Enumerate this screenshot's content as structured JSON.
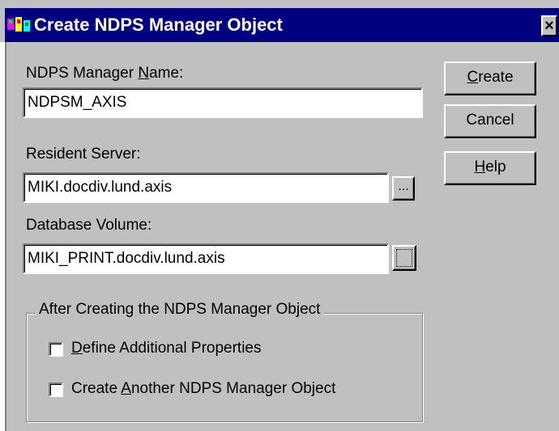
{
  "window": {
    "title": "Create NDPS Manager Object",
    "close_label": "×"
  },
  "manager_name": {
    "label_pre": "NDPS Manager ",
    "label_access": "N",
    "label_post": "ame:",
    "value": "NDPSM_AXIS"
  },
  "resident_server": {
    "label": "Resident Server:",
    "value": "MIKI.docdiv.lund.axis",
    "browse_label": "..."
  },
  "database_volume": {
    "label": "Database Volume:",
    "value": "MIKI_PRINT.docdiv.lund.axis"
  },
  "buttons": {
    "create_access": "C",
    "create_rest": "reate",
    "cancel_label": "Cancel",
    "help_access": "H",
    "help_rest": "elp"
  },
  "after_group": {
    "title": "After Creating the NDPS Manager Object",
    "define_access": "D",
    "define_rest": "efine Additional Properties",
    "define_checked": false,
    "another_pre": "Create ",
    "another_access": "A",
    "another_rest": "nother NDPS Manager Object",
    "another_checked": false
  },
  "colors": {
    "titlebar": "#000080",
    "face": "#c0c0c0"
  }
}
